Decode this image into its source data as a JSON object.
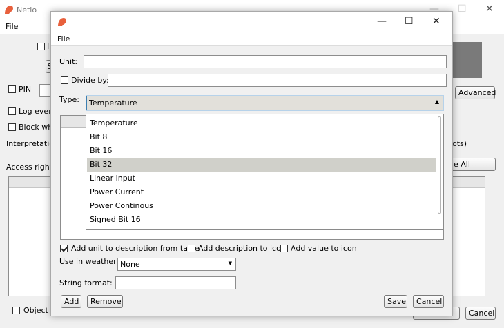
{
  "main_window": {
    "title": "Netio",
    "menu": {
      "file": "File"
    },
    "controls": {
      "minimize": "—",
      "maximize": "☐",
      "close": "✕"
    },
    "pin_label": "PIN",
    "log_every_label": "Log every",
    "block_label": "Block whe",
    "interpretation_label": "Interpretation",
    "access_rights_label": "Access rights",
    "object_label": "Object is",
    "advanced_label": "Advanced",
    "select_all_label": "e All",
    "plots_label": "ots)",
    "save_label": "Save",
    "cancel_label": "Cancel",
    "partial_i": "I",
    "partial_s": "S"
  },
  "dialog": {
    "menu": {
      "file": "File"
    },
    "controls": {
      "minimize": "—",
      "maximize": "☐",
      "close": "✕"
    },
    "unit": {
      "label": "Unit:",
      "value": ""
    },
    "divide_by": {
      "label": "Divide by:",
      "checked": false,
      "value": ""
    },
    "type": {
      "label": "Type:",
      "selected": "Temperature",
      "options": [
        "Temperature",
        "Bit 8",
        "Bit 16",
        "Bit 32",
        "Linear input",
        "Power Current",
        "Power Continous",
        "Signed Bit 16"
      ],
      "highlighted_index": 3
    },
    "add_unit_label": "Add unit to description from table",
    "add_unit_checked": true,
    "add_desc_icon_label": "Add description to icon",
    "add_desc_icon_checked": false,
    "add_value_icon_label": "Add value to icon",
    "add_value_icon_checked": false,
    "weather": {
      "label": "Use in weather",
      "selected": "None"
    },
    "string_format": {
      "label": "String format:",
      "value": ""
    },
    "buttons": {
      "add": "Add",
      "remove": "Remove",
      "save": "Save",
      "cancel": "Cancel"
    }
  },
  "colors": {
    "accent_border": "#3c7fb1",
    "logo": "#e8603c",
    "selection": "#d0d0ca"
  }
}
